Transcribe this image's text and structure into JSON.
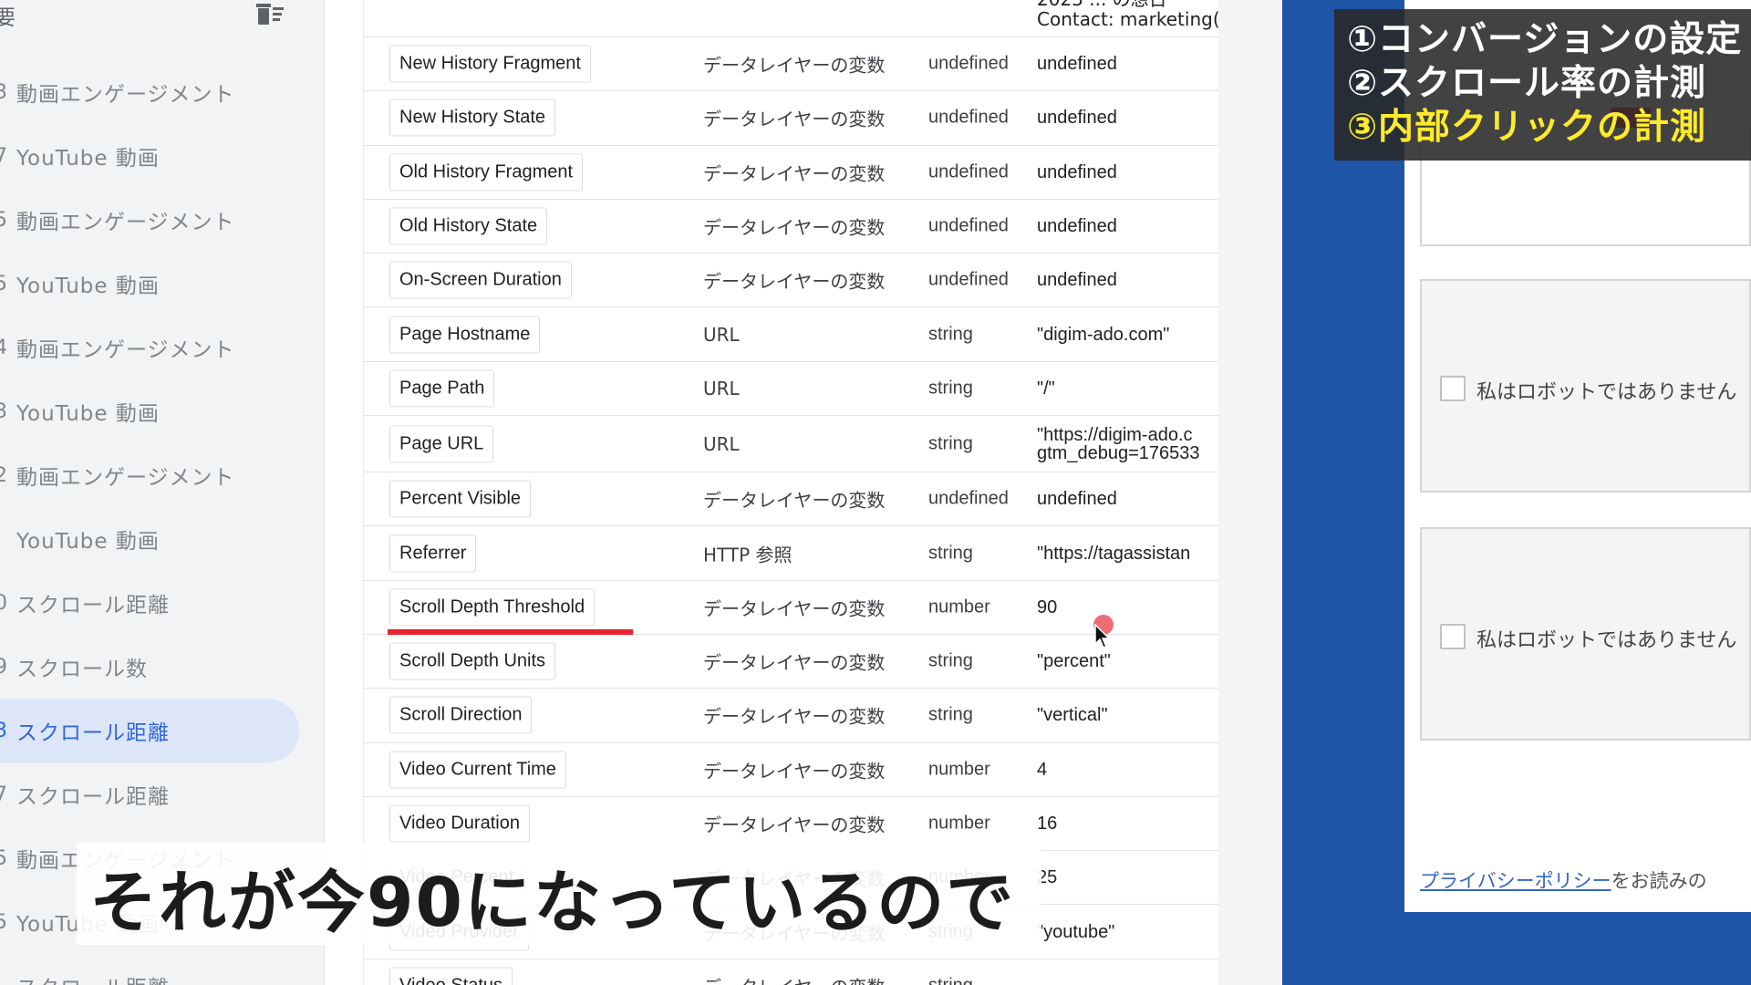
{
  "sidebar": {
    "title": "要",
    "items": [
      {
        "num": "3",
        "label": "動画エンゲージメント"
      },
      {
        "num": "7",
        "label": "YouTube 動画"
      },
      {
        "num": "5",
        "label": "動画エンゲージメント"
      },
      {
        "num": "5",
        "label": "YouTube 動画"
      },
      {
        "num": "4",
        "label": "動画エンゲージメント"
      },
      {
        "num": "3",
        "label": "YouTube 動画"
      },
      {
        "num": "2",
        "label": "動画エンゲージメント"
      },
      {
        "num": "",
        "label": "YouTube 動画"
      },
      {
        "num": "0",
        "label": "スクロール距離"
      },
      {
        "num": "9",
        "label": "スクロール数"
      },
      {
        "num": "3",
        "label": "スクロール距離",
        "active": true
      },
      {
        "num": "7",
        "label": "スクロール距離"
      },
      {
        "num": "5",
        "label": "動画エンゲージメント"
      },
      {
        "num": "5",
        "label": "YouTube 動画"
      },
      {
        "num": "",
        "label": "スクロール距離"
      }
    ]
  },
  "variables": {
    "top_value": [
      "2023 ... の想日",
      "Contact: marketing("
    ],
    "rows": [
      {
        "name": "New History Fragment",
        "type": "データレイヤーの変数",
        "data_type": "undefined",
        "value": "undefined"
      },
      {
        "name": "New History State",
        "type": "データレイヤーの変数",
        "data_type": "undefined",
        "value": "undefined"
      },
      {
        "name": "Old History Fragment",
        "type": "データレイヤーの変数",
        "data_type": "undefined",
        "value": "undefined"
      },
      {
        "name": "Old History State",
        "type": "データレイヤーの変数",
        "data_type": "undefined",
        "value": "undefined"
      },
      {
        "name": "On-Screen Duration",
        "type": "データレイヤーの変数",
        "data_type": "undefined",
        "value": "undefined"
      },
      {
        "name": "Page Hostname",
        "type": "URL",
        "data_type": "string",
        "value": "\"digim-ado.com\""
      },
      {
        "name": "Page Path",
        "type": "URL",
        "data_type": "string",
        "value": "\"/\""
      },
      {
        "name": "Page URL",
        "type": "URL",
        "data_type": "string",
        "value": "\"https://digim-ado.c\ngtm_debug=176533"
      },
      {
        "name": "Percent Visible",
        "type": "データレイヤーの変数",
        "data_type": "undefined",
        "value": "undefined"
      },
      {
        "name": "Referrer",
        "type": "HTTP 参照",
        "data_type": "string",
        "value": "\"https://tagassistan"
      },
      {
        "name": "Scroll Depth Threshold",
        "type": "データレイヤーの変数",
        "data_type": "number",
        "value": "90",
        "highlighted": true
      },
      {
        "name": "Scroll Depth Units",
        "type": "データレイヤーの変数",
        "data_type": "string",
        "value": "\"percent\""
      },
      {
        "name": "Scroll Direction",
        "type": "データレイヤーの変数",
        "data_type": "string",
        "value": "\"vertical\""
      },
      {
        "name": "Video Current Time",
        "type": "データレイヤーの変数",
        "data_type": "number",
        "value": "4"
      },
      {
        "name": "Video Duration",
        "type": "データレイヤーの変数",
        "data_type": "number",
        "value": "16"
      },
      {
        "name": "Video Percent",
        "type": "データレイヤーの変数",
        "data_type": "number",
        "value": "25"
      },
      {
        "name": "Video Provider",
        "type": "データレイヤーの変数",
        "data_type": "string",
        "value": "\"youtube\""
      },
      {
        "name": "Video Status",
        "type": "データレイヤーの変数",
        "data_type": "string",
        "value": ""
      }
    ]
  },
  "overlay": {
    "steps": [
      "①コンバージョンの設定",
      "②スクロール率の計測",
      "③内部クリックの計測"
    ],
    "highlight_color": "#ffeb2a"
  },
  "site": {
    "captcha_label": "私はロボットではありません",
    "privacy_link": "プライバシーポリシー",
    "privacy_rest": "をお読みの"
  },
  "caption": "それが今90になっているので",
  "colors": {
    "accent_blue": "#3367d6",
    "frame_blue": "#1e55a6",
    "underline_red": "#e8222e"
  }
}
